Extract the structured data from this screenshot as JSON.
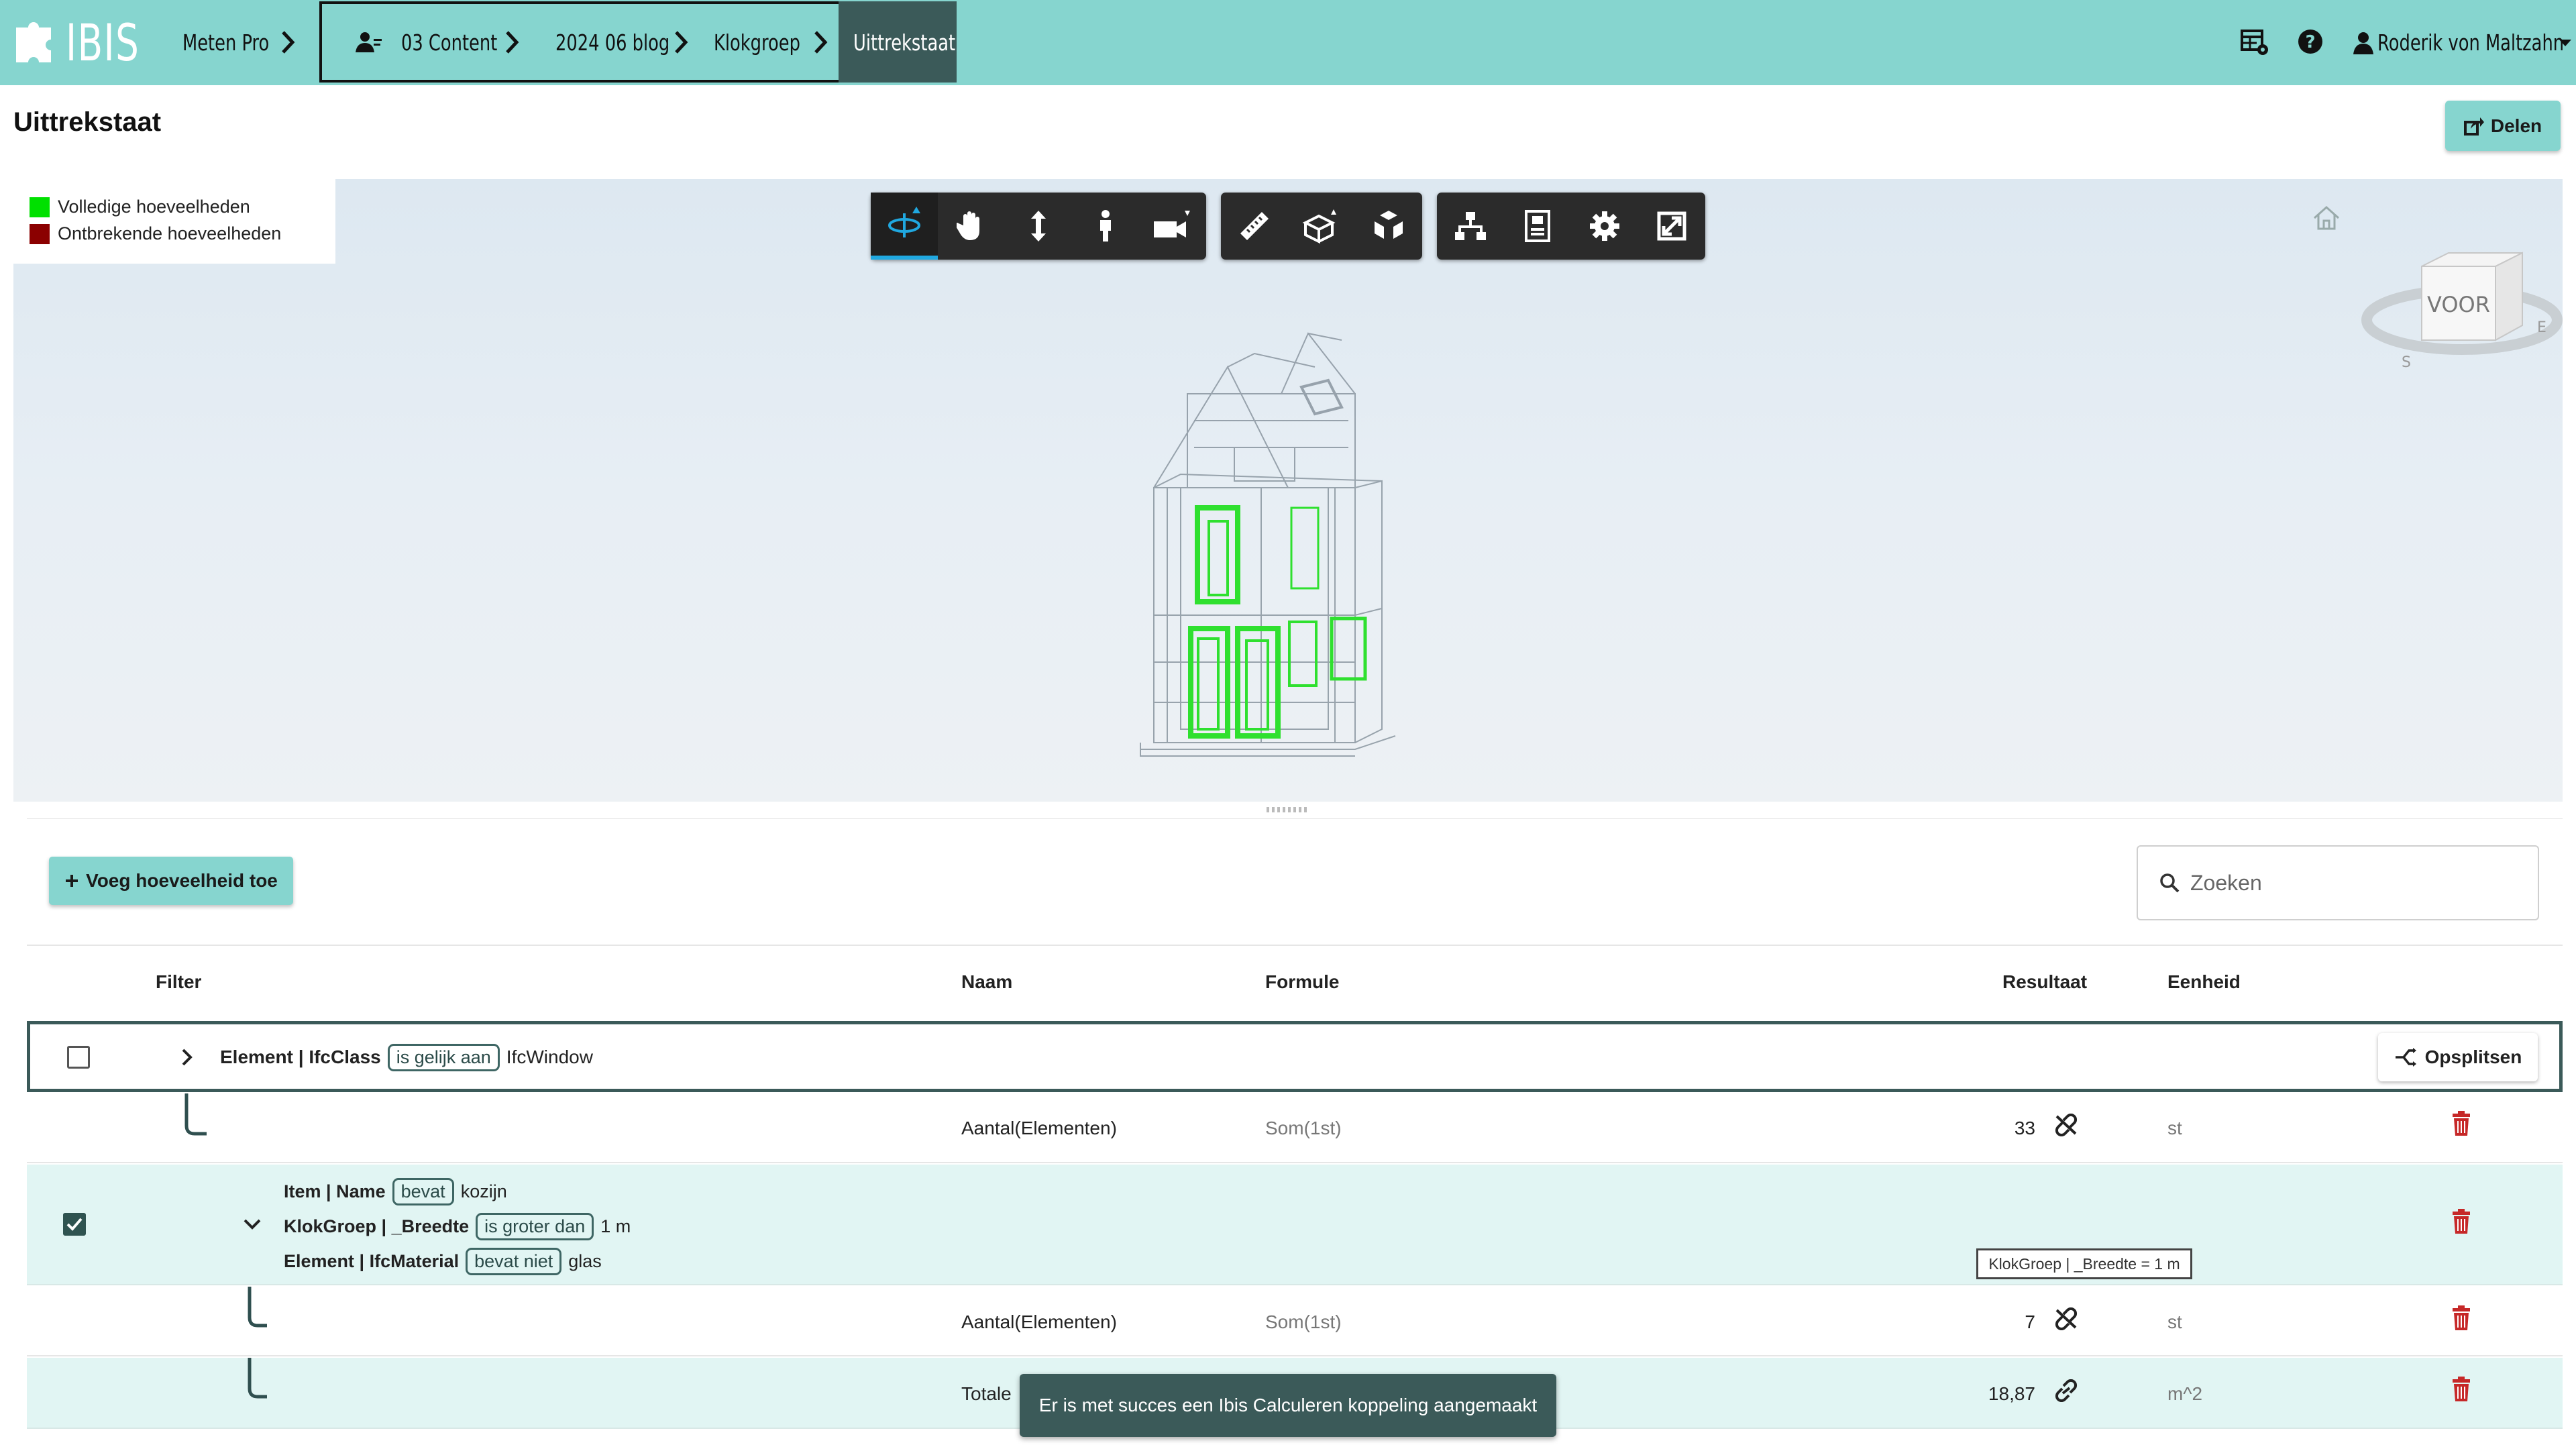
{
  "app": {
    "logo_text": "IBIS",
    "brand_color": "#86d5cf",
    "active_crumb_color": "#3b5a59"
  },
  "breadcrumb": {
    "items": [
      "Meten Pro",
      "03 Content",
      "2024 06 blog",
      "Klokgroep",
      "Uittrekstaat"
    ]
  },
  "user": {
    "name": "Roderik von Maltzahn"
  },
  "nav_icons": [
    "table-settings-icon",
    "help-icon",
    "user-icon",
    "caret-down-icon"
  ],
  "page": {
    "title": "Uittrekstaat",
    "share_label": "Delen"
  },
  "viewer": {
    "legend": [
      {
        "label": "Volledige hoeveelheden",
        "color": "#00e000"
      },
      {
        "label": "Ontbrekende hoeveelheden",
        "color": "#8b0000"
      }
    ],
    "toolbar_groups": [
      [
        "orbit-icon",
        "pan-icon",
        "zoom-icon",
        "walk-icon",
        "camera-icon"
      ],
      [
        "measure-icon",
        "section-icon",
        "explode-icon"
      ],
      [
        "model-browser-icon",
        "properties-icon",
        "settings-icon",
        "fullscreen-icon"
      ]
    ],
    "viewcube_label": "VOOR"
  },
  "panel": {
    "add_button": "Voeg hoeveelheid toe",
    "search_placeholder": "Zoeken",
    "columns": {
      "filter": "Filter",
      "name": "Naam",
      "formula": "Formule",
      "result": "Resultaat",
      "unit": "Eenheid"
    },
    "group1": {
      "filter_field": "Element | IfcClass",
      "filter_op": "is gelijk aan",
      "filter_value": "IfcWindow",
      "split_button": "Opsplitsen",
      "row": {
        "name": "Aantal(Elementen)",
        "formula": "Som(1st)",
        "result": "33",
        "unit": "st"
      }
    },
    "group2": {
      "filters": [
        {
          "field": "Item | Name",
          "op": "bevat",
          "value": "kozijn"
        },
        {
          "field": "KlokGroep | _Breedte",
          "op": "is groter dan",
          "value": "1 m"
        },
        {
          "field": "Element | IfcMaterial",
          "op": "bevat niet",
          "value": "glas"
        }
      ],
      "tooltip": "KlokGroep | _Breedte = 1 m",
      "rows": [
        {
          "name": "Aantal(Elementen)",
          "formula": "Som(1st)",
          "result": "7",
          "unit": "st"
        },
        {
          "name": "Totale",
          "formula": "",
          "result": "18,87",
          "unit": "m^2"
        }
      ]
    },
    "toast": "Er is met succes een Ibis Calculeren koppeling aangemaakt"
  }
}
